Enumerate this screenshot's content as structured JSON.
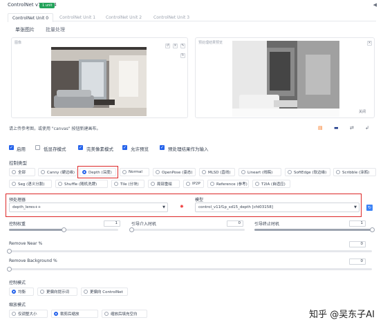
{
  "header": {
    "title": "ControlNet v1.1.224",
    "badge": "1 unit"
  },
  "unit_tabs": [
    "ControlNet Unit 0",
    "ControlNet Unit 1",
    "ControlNet Unit 2",
    "ControlNet Unit 3"
  ],
  "image_tabs": [
    "单张图片",
    "批量处理"
  ],
  "input_panel_label": "图像",
  "preview_panel_label": "预处理结果预览",
  "preview_close_label": "关闭",
  "hint_text": "请上传参考图，或使用 \"canvas\" 按钮新建画布。",
  "checkboxes": [
    {
      "label": "启用",
      "checked": true
    },
    {
      "label": "低显存模式",
      "checked": false
    },
    {
      "label": "完美像素模式",
      "checked": true
    },
    {
      "label": "允许预览",
      "checked": true
    },
    {
      "label": "预处理结果作为输入",
      "checked": true
    }
  ],
  "control_type_label": "控制类型",
  "control_types_row1": [
    "全部",
    "Canny (硬边缘)",
    "Depth (深度)",
    "Normal",
    "OpenPose (姿态)",
    "MLSD (直线)",
    "Lineart (线稿)",
    "SoftEdge (软边缘)",
    "Scribble (涂鸦)"
  ],
  "control_types_row2": [
    "Seg (语义分割)",
    "Shuffle (随机洗牌)",
    "Tile (分块)",
    "局部重绘",
    "IP2P",
    "Reference (参考)",
    "T2IA (自适应)"
  ],
  "selected_control_type": "Depth (深度)",
  "preprocessor": {
    "label": "预处理器",
    "value": "depth_leres++"
  },
  "model": {
    "label": "模型",
    "value": "control_v11f1p_sd15_depth [cfd03158]"
  },
  "sliders": {
    "control_weight": {
      "label": "控制权重",
      "value": "1",
      "fraction": 0.5
    },
    "start_step": {
      "label": "引导介入时机",
      "value": "0",
      "fraction": 0
    },
    "end_step": {
      "label": "引导终止时机",
      "value": "1",
      "fraction": 1
    },
    "remove_near": {
      "label": "Remove Near %",
      "value": "0",
      "fraction": 0
    },
    "remove_background": {
      "label": "Remove Background %",
      "value": "0",
      "fraction": 0
    }
  },
  "control_mode": {
    "label": "控制模式",
    "options": [
      "均衡",
      "更偏向提示词",
      "更偏向 ControlNet"
    ],
    "selected": 0
  },
  "resize_mode": {
    "label": "缩放模式",
    "options": [
      "仅调整大小",
      "裁剪后缩放",
      "缩放后填充空白"
    ],
    "selected": 1
  },
  "watermark": "知乎 @吴东子AI",
  "colors": {
    "accent": "#2563eb",
    "highlight": "#dc2626",
    "badge": "#22a35a"
  }
}
